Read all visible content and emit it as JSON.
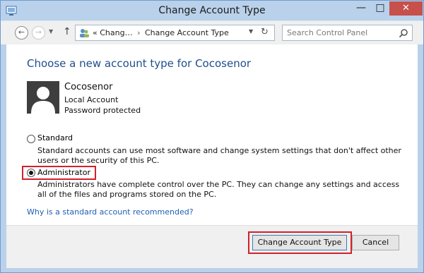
{
  "window": {
    "title": "Change Account Type",
    "controls": {
      "minimize": "—",
      "maximize": "□",
      "close": "✕"
    }
  },
  "navigation": {
    "breadcrumb": [
      "Chang…",
      "Change Account Type"
    ],
    "breadcrumb_prefix": "«",
    "search_placeholder": "Search Control Panel"
  },
  "main": {
    "heading": "Choose a new account type for Cocosenor",
    "account": {
      "name": "Cocosenor",
      "type": "Local Account",
      "password_status": "Password protected"
    },
    "options": [
      {
        "label": "Standard",
        "description": "Standard accounts can use most software and change system settings that don't affect other users or the security of this PC.",
        "selected": false
      },
      {
        "label": "Administrator",
        "description": "Administrators have complete control over the PC. They can change any settings and access all of the files and programs stored on the PC.",
        "selected": true
      }
    ],
    "help_link": "Why is a standard account recommended?"
  },
  "footer": {
    "primary_button": "Change Account Type",
    "cancel_button": "Cancel"
  },
  "colors": {
    "frame": "#b9d1ea",
    "heading": "#1e4e8c",
    "link": "#1e5fb3",
    "highlight": "#d4202a",
    "close_button": "#c7504b"
  }
}
